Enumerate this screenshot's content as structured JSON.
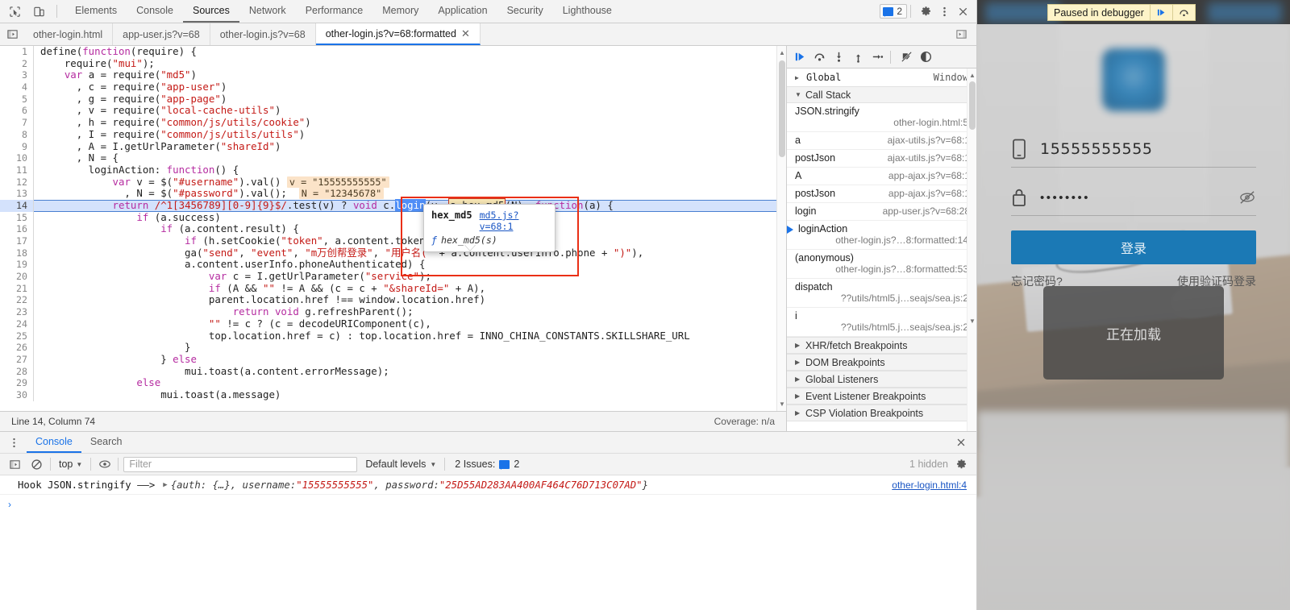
{
  "devtools": {
    "main_tabs": [
      {
        "label": "Elements",
        "active": false
      },
      {
        "label": "Console",
        "active": false
      },
      {
        "label": "Sources",
        "active": true
      },
      {
        "label": "Network",
        "active": false
      },
      {
        "label": "Performance",
        "active": false
      },
      {
        "label": "Memory",
        "active": false
      },
      {
        "label": "Application",
        "active": false
      },
      {
        "label": "Security",
        "active": false
      },
      {
        "label": "Lighthouse",
        "active": false
      }
    ],
    "issues_count": "2",
    "icons": {
      "inspect": "inspect-element-icon",
      "device": "device-toolbar-icon",
      "settings": "gear-icon",
      "more": "more-options-icon",
      "close": "close-icon"
    },
    "source_tabs": [
      {
        "label": "other-login.html",
        "active": false,
        "closable": false
      },
      {
        "label": "app-user.js?v=68",
        "active": false,
        "closable": false
      },
      {
        "label": "other-login.js?v=68",
        "active": false,
        "closable": false
      },
      {
        "label": "other-login.js?v=68:formatted",
        "active": true,
        "closable": true
      }
    ],
    "tab_close_glyph": "✕"
  },
  "editor": {
    "lines": [
      {
        "n": "1",
        "html": "<span class=\"plain\">define(</span><span class=\"kw\">function</span><span class=\"plain\">(require) {</span>"
      },
      {
        "n": "2",
        "html": "<span class=\"plain\">    require(</span><span class=\"str\">\"mui\"</span><span class=\"plain\">);</span>"
      },
      {
        "n": "3",
        "html": "<span class=\"plain\">    </span><span class=\"kw\">var</span><span class=\"plain\"> a = require(</span><span class=\"str\">\"md5\"</span><span class=\"plain\">)</span>"
      },
      {
        "n": "4",
        "html": "<span class=\"plain\">      , c = require(</span><span class=\"str\">\"app-user\"</span><span class=\"plain\">)</span>"
      },
      {
        "n": "5",
        "html": "<span class=\"plain\">      , g = require(</span><span class=\"str\">\"app-page\"</span><span class=\"plain\">)</span>"
      },
      {
        "n": "6",
        "html": "<span class=\"plain\">      , v = require(</span><span class=\"str\">\"local-cache-utils\"</span><span class=\"plain\">)</span>"
      },
      {
        "n": "7",
        "html": "<span class=\"plain\">      , h = require(</span><span class=\"str\">\"common/js/utils/cookie\"</span><span class=\"plain\">)</span>"
      },
      {
        "n": "8",
        "html": "<span class=\"plain\">      , I = require(</span><span class=\"str\">\"common/js/utils/utils\"</span><span class=\"plain\">)</span>"
      },
      {
        "n": "9",
        "html": "<span class=\"plain\">      , A = I.getUrlParameter(</span><span class=\"str\">\"shareId\"</span><span class=\"plain\">)</span>"
      },
      {
        "n": "10",
        "html": "<span class=\"plain\">      , N = {</span>"
      },
      {
        "n": "11",
        "html": "<span class=\"plain\">        loginAction: </span><span class=\"kw\">function</span><span class=\"plain\">() {</span>"
      },
      {
        "n": "12",
        "html": "<span class=\"plain\">            </span><span class=\"kw\">var</span><span class=\"plain\"> v = $(</span><span class=\"str\">\"#username\"</span><span class=\"plain\">).val() </span><span class=\"inline-val\">v = \"15555555555\"</span>"
      },
      {
        "n": "13",
        "html": "<span class=\"plain\">              , N = $(</span><span class=\"str\">\"#password\"</span><span class=\"plain\">).val();  </span><span class=\"inline-val\">N = \"12345678\"</span>"
      },
      {
        "n": "14",
        "html": "<span class=\"plain\">            </span><span class=\"kw\">return</span><span class=\"plain\"> </span><span class=\"reg\">/^1[3456789][0-9]{9}$/</span><span class=\"plain\">.test(v) ? </span><span class=\"kw\">void</span><span class=\"plain\"> c.</span><span class=\"tok-sel\">login</span><span class=\"plain\">(v, </span><span class=\"tok-box\">a.hex_md5</span><span class=\"plain\">(N), </span><span class=\"kw\">function</span><span class=\"plain\">(a) {</span>",
        "exec": true
      },
      {
        "n": "15",
        "html": "<span class=\"plain\">                </span><span class=\"kw\">if</span><span class=\"plain\"> (a.success)</span>"
      },
      {
        "n": "16",
        "html": "<span class=\"plain\">                    </span><span class=\"kw\">if</span><span class=\"plain\"> (a.content.result) {</span>"
      },
      {
        "n": "17",
        "html": "<span class=\"plain\">                        </span><span class=\"kw\">if</span><span class=\"plain\"> (h.setCookie(</span><span class=\"str\">\"token\"</span><span class=\"plain\">, a.content.token),</span>"
      },
      {
        "n": "18",
        "html": "<span class=\"plain\">                        ga(</span><span class=\"str\">\"send\"</span><span class=\"plain\">, </span><span class=\"str\">\"event\"</span><span class=\"plain\">, </span><span class=\"str\">\"m万创帮登录\"</span><span class=\"plain\">, </span><span class=\"str\">\"用户名(\"</span><span class=\"plain\"> + a.content.userInfo.phone + </span><span class=\"str\">\")\"</span><span class=\"plain\">),</span>"
      },
      {
        "n": "19",
        "html": "<span class=\"plain\">                        a.content.userInfo.phoneAuthenticated) {</span>"
      },
      {
        "n": "20",
        "html": "<span class=\"plain\">                            </span><span class=\"kw\">var</span><span class=\"plain\"> c = I.getUrlParameter(</span><span class=\"str\">\"service\"</span><span class=\"plain\">);</span>"
      },
      {
        "n": "21",
        "html": "<span class=\"plain\">                            </span><span class=\"kw\">if</span><span class=\"plain\"> (A &amp;&amp; </span><span class=\"str\">\"\"</span><span class=\"plain\"> != A &amp;&amp; (c = c + </span><span class=\"str\">\"&amp;shareId=\"</span><span class=\"plain\"> + A),</span>"
      },
      {
        "n": "22",
        "html": "<span class=\"plain\">                            parent.location.href !== window.location.href)</span>"
      },
      {
        "n": "23",
        "html": "<span class=\"plain\">                                </span><span class=\"kw\">return</span><span class=\"plain\"> </span><span class=\"kw\">void</span><span class=\"plain\"> g.refreshParent();</span>"
      },
      {
        "n": "24",
        "html": "<span class=\"plain\">                            </span><span class=\"str\">\"\"</span><span class=\"plain\"> != c ? (c = decodeURIComponent(c),</span>"
      },
      {
        "n": "25",
        "html": "<span class=\"plain\">                            top.location.href = c) : top.location.href = INNO_CHINA_CONSTANTS.SKILLSHARE_URL</span>"
      },
      {
        "n": "26",
        "html": "<span class=\"plain\">                        }</span>"
      },
      {
        "n": "27",
        "html": "<span class=\"plain\">                    } </span><span class=\"kw\">else</span>"
      },
      {
        "n": "28",
        "html": "<span class=\"plain\">                        mui.toast(a.content.errorMessage);</span>"
      },
      {
        "n": "29",
        "html": "<span class=\"plain\">                </span><span class=\"kw\">else</span>"
      },
      {
        "n": "30",
        "html": "<span class=\"plain\">                    mui.toast(a.message)</span>"
      }
    ],
    "tooltip": {
      "name": "hex_md5",
      "link": "md5.js?v=68:1",
      "signature": "hex_md5(s)",
      "f_glyph": "ƒ"
    },
    "status": {
      "position": "Line 14, Column 74",
      "coverage": "Coverage: n/a"
    }
  },
  "debugger": {
    "toolbar_icons": [
      "resume-script-icon",
      "step-over-icon",
      "step-into-icon",
      "step-out-icon",
      "step-icon",
      "deactivate-breakpoints-icon",
      "pause-on-exceptions-icon"
    ],
    "scope_rows": [
      {
        "name": "Global",
        "value": "Window"
      }
    ],
    "call_stack_title": "Call Stack",
    "call_stack": [
      {
        "name": "JSON.stringify",
        "loc": "other-login.html:5",
        "layout": "two",
        "active": false
      },
      {
        "name": "a",
        "loc": "ajax-utils.js?v=68:1",
        "layout": "one",
        "active": false
      },
      {
        "name": "postJson",
        "loc": "ajax-utils.js?v=68:1",
        "layout": "one",
        "active": false
      },
      {
        "name": "A",
        "loc": "app-ajax.js?v=68:1",
        "layout": "one",
        "active": false
      },
      {
        "name": "postJson",
        "loc": "app-ajax.js?v=68:1",
        "layout": "one",
        "active": false
      },
      {
        "name": "login",
        "loc": "app-user.js?v=68:28",
        "layout": "one",
        "active": false
      },
      {
        "name": "loginAction",
        "loc": "other-login.js?…8:formatted:14",
        "layout": "two",
        "active": true
      },
      {
        "name": "(anonymous)",
        "loc": "other-login.js?…8:formatted:53",
        "layout": "two",
        "active": false
      },
      {
        "name": "dispatch",
        "loc": "??utils/html5.j…seajs/sea.js:2",
        "layout": "two",
        "active": false
      },
      {
        "name": "i",
        "loc": "??utils/html5.j…seajs/sea.js:2",
        "layout": "two",
        "active": false
      }
    ],
    "collapsed_panes": [
      "XHR/fetch Breakpoints",
      "DOM Breakpoints",
      "Global Listeners",
      "Event Listener Breakpoints",
      "CSP Violation Breakpoints"
    ]
  },
  "console": {
    "tabs": [
      {
        "label": "Console",
        "active": true
      },
      {
        "label": "Search",
        "active": false
      }
    ],
    "context": "top",
    "filter_placeholder": "Filter",
    "filter_value": "",
    "levels": "Default levels",
    "issues_label": "2 Issues:",
    "issues_count": "2",
    "hidden_label": "1 hidden",
    "log": {
      "message": "Hook JSON.stringify ——>",
      "object_prefix": "{auth: {…}, username: ",
      "username_value": "\"15555555555\"",
      "object_mid": ", password: ",
      "password_value": "\"25D55AD283AA400AF464C76D713C07AD\"",
      "object_suffix": "}",
      "source": "other-login.html:4"
    },
    "prompt_glyph": "›"
  },
  "viewport": {
    "paused_banner": {
      "text": "Paused in debugger",
      "resume_icon": "resume-script-icon",
      "step_over_icon": "step-over-icon"
    },
    "login": {
      "phone_icon": "mobile-phone-icon",
      "phone_value": "15555555555",
      "lock_icon": "lock-icon",
      "password_value": "••••••••",
      "eye_icon": "eye-slash-icon",
      "submit_label": "登录",
      "forgot_label": "忘记密码?",
      "sms_label": "使用验证码登录"
    },
    "toast": "正在加载"
  },
  "colors": {
    "accent_blue": "#1a73e8",
    "login_button": "#1b79b5",
    "exec_line": "#d4e2fc",
    "highlight_box": "#cc3b24",
    "inline_value_bg": "#fbe3c8"
  }
}
